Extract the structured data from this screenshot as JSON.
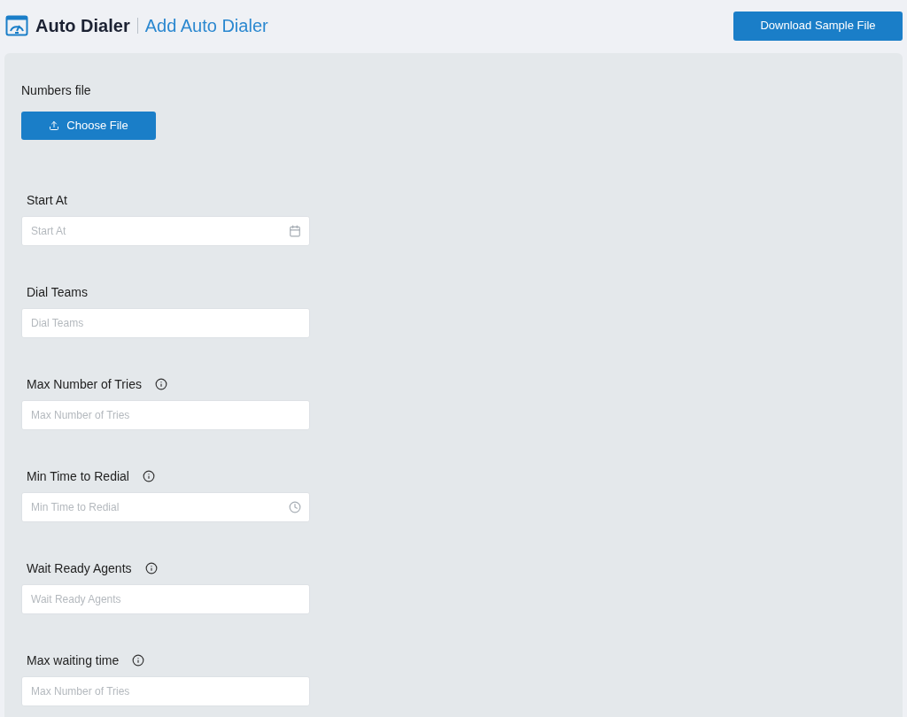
{
  "header": {
    "title": "Auto Dialer",
    "subtitle": "Add Auto Dialer",
    "action": "Download Sample File"
  },
  "upload": {
    "label": "Numbers file",
    "button": "Choose File"
  },
  "fields": [
    {
      "label": "Start At",
      "placeholder": "Start At",
      "kind": "date",
      "info": false
    },
    {
      "label": "Dial Teams",
      "placeholder": "Dial Teams",
      "kind": "text",
      "info": false
    },
    {
      "label": "Max Number of Tries",
      "placeholder": "Max Number of Tries",
      "kind": "text",
      "info": true
    },
    {
      "label": "Min Time to Redial",
      "placeholder": "Min Time to Redial",
      "kind": "time",
      "info": true
    },
    {
      "label": "Wait Ready Agents",
      "placeholder": "Wait Ready Agents",
      "kind": "text",
      "info": true
    },
    {
      "label": "Max waiting time",
      "placeholder": "Max Number of Tries",
      "kind": "text",
      "info": true
    }
  ]
}
